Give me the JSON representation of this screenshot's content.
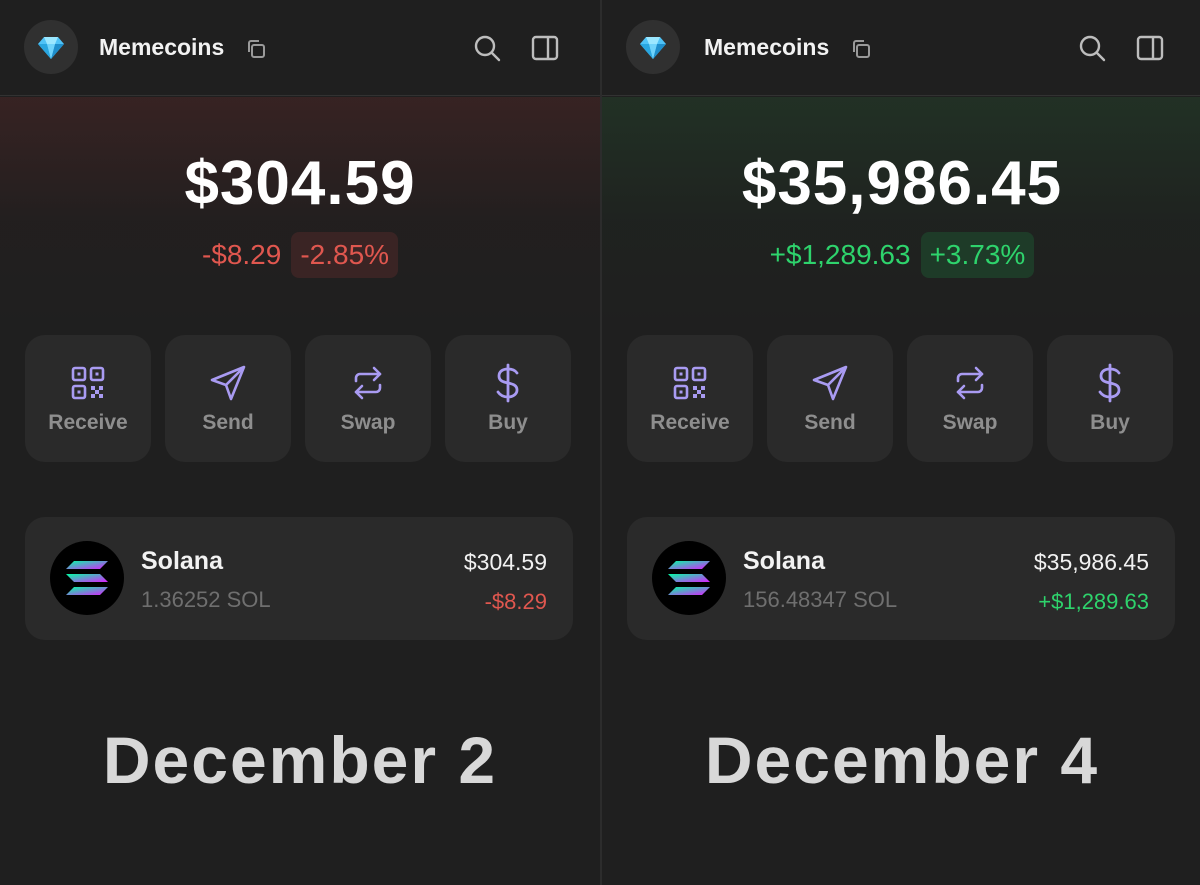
{
  "panels": [
    {
      "wallet_name": "Memecoins",
      "balance": "$304.59",
      "change_amount": "-$8.29",
      "change_percent": "-2.85%",
      "trend": "negative",
      "actions": [
        {
          "label": "Receive",
          "icon": "qr-code-icon"
        },
        {
          "label": "Send",
          "icon": "send-icon"
        },
        {
          "label": "Swap",
          "icon": "swap-icon"
        },
        {
          "label": "Buy",
          "icon": "dollar-icon"
        }
      ],
      "token": {
        "name": "Solana",
        "amount": "1.36252 SOL",
        "value": "$304.59",
        "delta": "-$8.29"
      },
      "date_label": "December 2"
    },
    {
      "wallet_name": "Memecoins",
      "balance": "$35,986.45",
      "change_amount": "+$1,289.63",
      "change_percent": "+3.73%",
      "trend": "positive",
      "actions": [
        {
          "label": "Receive",
          "icon": "qr-code-icon"
        },
        {
          "label": "Send",
          "icon": "send-icon"
        },
        {
          "label": "Swap",
          "icon": "swap-icon"
        },
        {
          "label": "Buy",
          "icon": "dollar-icon"
        }
      ],
      "token": {
        "name": "Solana",
        "amount": "156.48347 SOL",
        "value": "$35,986.45",
        "delta": "+$1,289.63"
      },
      "date_label": "December 4"
    }
  ],
  "colors": {
    "background": "#1f1f1f",
    "card": "#2a2a2a",
    "accent_icon": "#a99bf2",
    "negative": "#e0574f",
    "positive": "#2ed36c"
  }
}
